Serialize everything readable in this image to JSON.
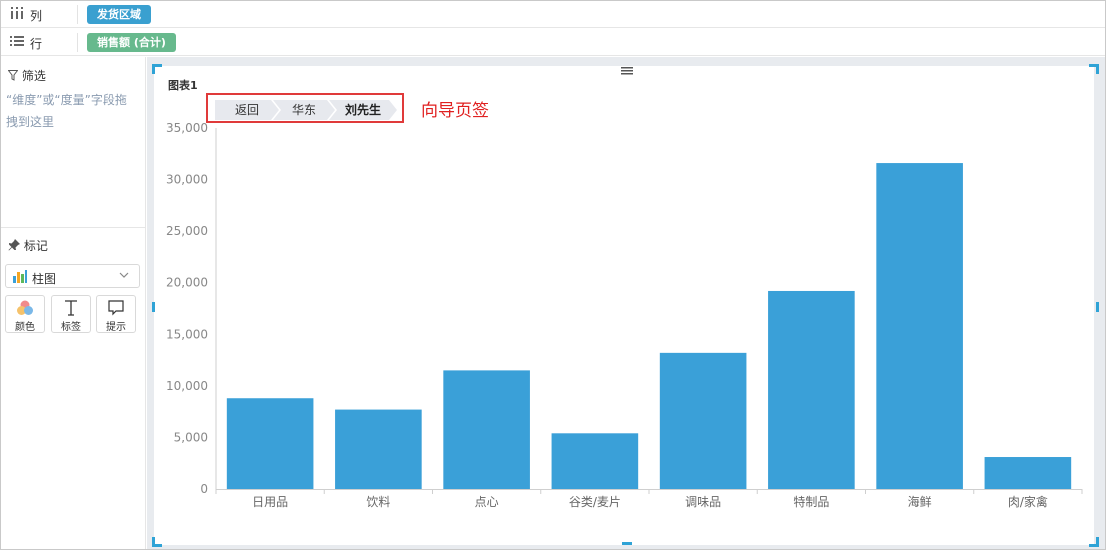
{
  "shelves": {
    "columns": {
      "label": "列",
      "field": "发货区域"
    },
    "rows": {
      "label": "行",
      "field": "销售额 (合计)"
    }
  },
  "filter": {
    "title": "筛选",
    "hint": "“维度”或“度量”字段拖拽到这里"
  },
  "marks": {
    "title": "标记",
    "chart_type": "柱图",
    "buttons": [
      {
        "label": "颜色",
        "icon": "color-palette-icon"
      },
      {
        "label": "标签",
        "icon": "text-t-icon"
      },
      {
        "label": "提示",
        "icon": "tooltip-bubble-icon"
      }
    ]
  },
  "chart": {
    "title": "图表1",
    "breadcrumb": [
      "返回",
      "华东",
      "刘先生"
    ],
    "annotation": "向导页签"
  },
  "colors": {
    "bar": "#3aa0d8",
    "columns_pill": "#3aa0d0",
    "rows_pill": "#67b98d",
    "annotation": "#e02020",
    "selection_handles": "#2fa3d6"
  },
  "chart_data": {
    "type": "bar",
    "categories": [
      "日用品",
      "饮料",
      "点心",
      "谷类/麦片",
      "调味品",
      "特制品",
      "海鲜",
      "肉/家禽"
    ],
    "values": [
      8800,
      7700,
      11500,
      5400,
      13200,
      19200,
      31600,
      3100
    ],
    "ylim": [
      0,
      35000
    ],
    "yticks": [
      0,
      5000,
      10000,
      15000,
      20000,
      25000,
      30000,
      35000
    ],
    "ytick_labels": [
      "0",
      "5,000",
      "10,000",
      "15,000",
      "20,000",
      "25,000",
      "30,000",
      "35,000"
    ],
    "grid": false,
    "legend": "none"
  }
}
